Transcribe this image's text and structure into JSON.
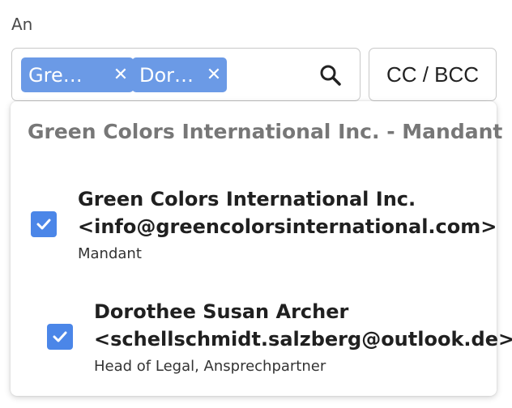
{
  "field_label": "An",
  "recipients": [
    {
      "label": "Gre…",
      "remove_icon": "close-icon"
    },
    {
      "label": "Dor…",
      "remove_icon": "close-icon"
    }
  ],
  "search": {
    "icon": "search-icon"
  },
  "cc_bcc_label": "CC / BCC",
  "dropdown": {
    "group_title": "Green Colors International Inc. - Mandant",
    "options": [
      {
        "name": "Green Colors International Inc.",
        "email": "<info@greencolorsinternational.com>",
        "role": "Mandant",
        "checked": true
      },
      {
        "name": "Dorothee Susan Archer",
        "email": "<schellschmidt.salzberg@outlook.de>",
        "role": "Head of Legal, Ansprechpartner",
        "checked": true
      }
    ]
  },
  "colors": {
    "chip": "#6b9ae6",
    "checkbox": "#4b86e8",
    "border": "#c8c8c8",
    "group_title": "#777777"
  }
}
